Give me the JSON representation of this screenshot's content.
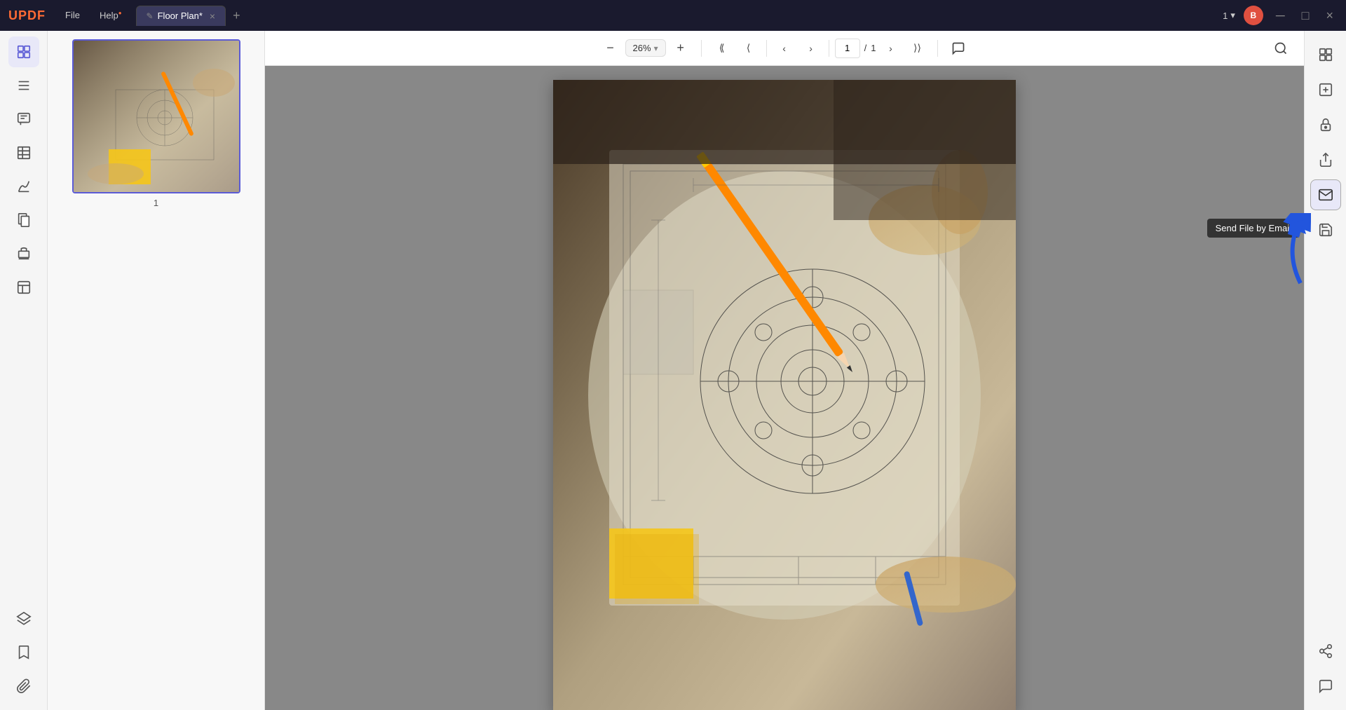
{
  "app": {
    "logo": "UPDF",
    "title": "Floor Plan*",
    "tab_icon": "✎"
  },
  "menu": {
    "items": [
      {
        "label": "File",
        "active": false
      },
      {
        "label": "Help",
        "has_dot": true,
        "active": false
      }
    ]
  },
  "tab": {
    "label": "Floor Plan*",
    "close_label": "×"
  },
  "user": {
    "number": "1",
    "avatar_initial": "B"
  },
  "toolbar": {
    "zoom_out_label": "−",
    "zoom_in_label": "+",
    "zoom_value": "26%",
    "zoom_dropdown": "▾",
    "page_current": "1",
    "page_total": "1",
    "page_separator": "/",
    "nav_first": "⟨⟨",
    "nav_prev": "⟨",
    "nav_next": "⟩",
    "nav_last": "⟩⟩",
    "comment_icon": "💬",
    "search_icon": "🔍"
  },
  "left_sidebar": {
    "icons": [
      {
        "name": "thumbnail-view-icon",
        "symbol": "⊞",
        "active": true
      },
      {
        "name": "document-outline-icon",
        "symbol": "≡"
      },
      {
        "name": "annotation-icon",
        "symbol": "✏"
      },
      {
        "name": "table-icon",
        "symbol": "⊟"
      },
      {
        "name": "signature-icon",
        "symbol": "✍"
      },
      {
        "name": "pages-icon",
        "symbol": "📄"
      },
      {
        "name": "stamps-icon",
        "symbol": "🔖"
      },
      {
        "name": "templates-icon",
        "symbol": "⊡"
      }
    ],
    "bottom_icons": [
      {
        "name": "layers-icon",
        "symbol": "◫"
      },
      {
        "name": "bookmark-icon",
        "symbol": "🔖"
      },
      {
        "name": "attachment-icon",
        "symbol": "📎"
      }
    ]
  },
  "thumbnail": {
    "page_number": "1"
  },
  "right_sidebar": {
    "icons": [
      {
        "name": "pdf-tools-icon",
        "symbol": "⊞"
      },
      {
        "name": "ocr-icon",
        "symbol": "T"
      },
      {
        "name": "protect-icon",
        "symbol": "🔒"
      },
      {
        "name": "share-icon",
        "symbol": "↑"
      },
      {
        "name": "send-email-icon",
        "symbol": "✉"
      },
      {
        "name": "save-icon",
        "symbol": "💾"
      }
    ],
    "bottom_icons": [
      {
        "name": "connect-icon",
        "symbol": "⊕"
      },
      {
        "name": "chat-icon",
        "symbol": "💬"
      }
    ]
  },
  "tooltip": {
    "label": "Send File by Email"
  },
  "colors": {
    "accent": "#5b5bd6",
    "logo": "#ff6b35",
    "blue_arrow": "#2255dd",
    "titlebar_bg": "#1a1a2e",
    "tooltip_bg": "#333333"
  }
}
